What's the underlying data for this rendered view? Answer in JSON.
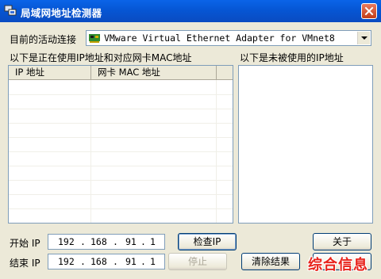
{
  "window": {
    "title": "局域网地址检测器"
  },
  "connection": {
    "label": "目前的活动连接",
    "selected": "VMware Virtual Ethernet Adapter for VMnet8"
  },
  "used_list": {
    "caption": "以下是正在使用IP地址和对应网卡MAC地址",
    "columns": [
      "IP 地址",
      "网卡 MAC 地址"
    ],
    "rows": []
  },
  "unused_list": {
    "caption": "以下是未被使用的IP地址",
    "items": []
  },
  "start_ip": {
    "label": "开始 IP",
    "octets": [
      "192",
      "168",
      "91",
      "1"
    ]
  },
  "end_ip": {
    "label": "结束 IP",
    "octets": [
      "192",
      "168",
      "91",
      "1"
    ]
  },
  "buttons": {
    "check": "检查IP",
    "stop": "停止",
    "about": "关于",
    "clear": "清除结果"
  },
  "watermark": "综合信息"
}
